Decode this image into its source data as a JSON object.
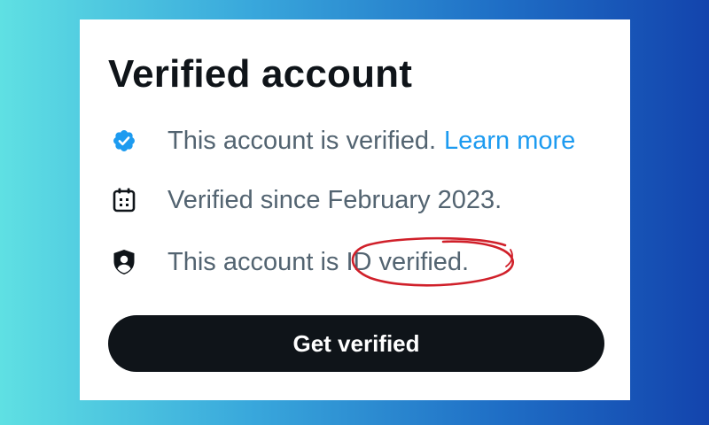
{
  "colors": {
    "background_gradient": [
      "#5fe0e3",
      "#39a8dc",
      "#1f6fc6",
      "#1344ad"
    ],
    "card": "#ffffff",
    "heading": "#0f1419",
    "secondary_text": "#536471",
    "link": "#1d9bf0",
    "verified_badge": "#1d9bf0",
    "button_bg": "#0f1419",
    "button_text": "#ffffff",
    "annotation": "#d0202a"
  },
  "card": {
    "title": "Verified account",
    "items": [
      {
        "icon": "verified-badge-icon",
        "text": "This account is verified.",
        "link_text": "Learn more"
      },
      {
        "icon": "calendar-icon",
        "text": "Verified since February 2023."
      },
      {
        "icon": "shield-person-icon",
        "text": "This account is ID verified."
      }
    ],
    "annotation": {
      "icon": "red-hand-drawn-circle",
      "highlights": "ID verified."
    },
    "button_label": "Get verified"
  }
}
